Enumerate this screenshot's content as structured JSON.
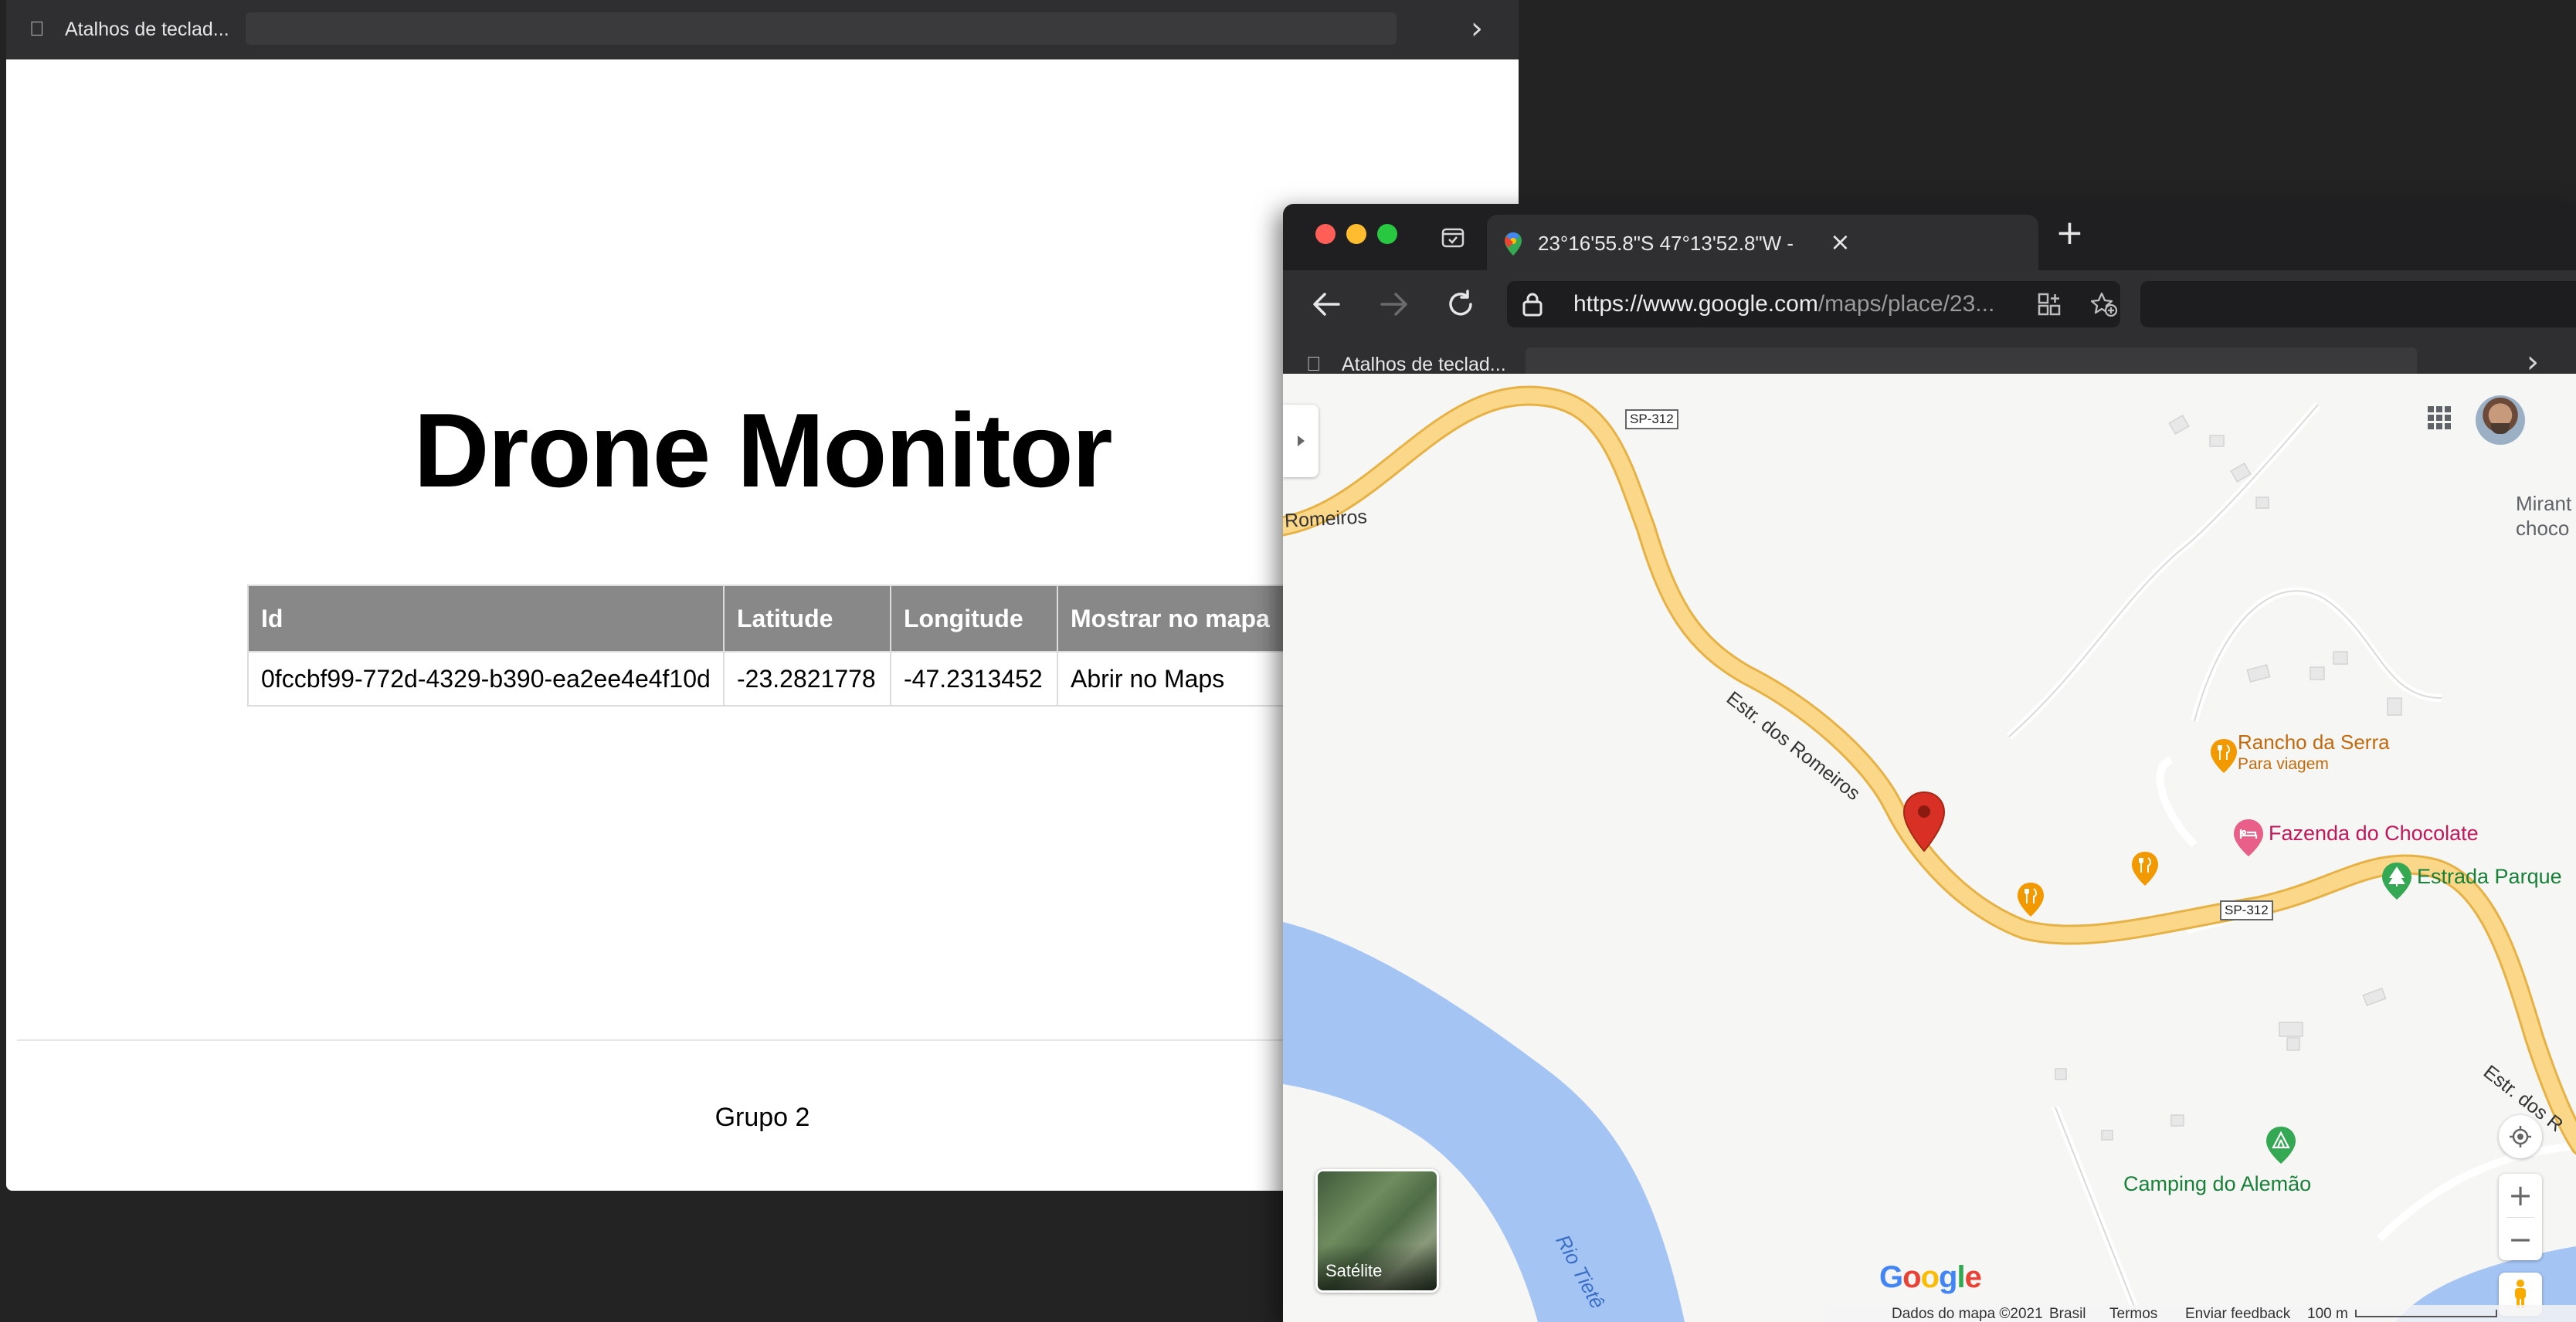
{
  "left_window": {
    "bookmarks_label": "Atalhos de teclad...",
    "page_title": "Drone Monitor",
    "table": {
      "headers": [
        "Id",
        "Latitude",
        "Longitude",
        "Mostrar no mapa"
      ],
      "rows": [
        {
          "id": "0fccbf99-772d-4329-b390-ea2ee4e4f10d",
          "latitude": "-23.2821778",
          "longitude": "-47.2313452",
          "action": "Abrir no Maps"
        }
      ]
    },
    "footer": "Grupo 2"
  },
  "right_window": {
    "tab_title": "23°16'55.8\"S 47°13'52.8\"W -",
    "url_host": "https://www.google.com",
    "url_path": "/maps/place/23...",
    "bookmarks_label": "Atalhos de teclad...",
    "map": {
      "road_shields": [
        "SP-312",
        "SP-312"
      ],
      "road_names": [
        "Romeiros",
        "Estr. dos Romeiros",
        "Estr. dos R"
      ],
      "river": "Rio Tietê",
      "places": [
        {
          "name": "Rancho da Serra",
          "subtitle": "Para viagem",
          "color": "#c26a0d"
        },
        {
          "name": "Fazenda do Chocolate",
          "color": "#c2185b"
        },
        {
          "name": "Estrada Parque",
          "color": "#188038"
        },
        {
          "name": "Camping do Alemão",
          "color": "#188038"
        },
        {
          "name": "Mirant\nchoco",
          "color": "#5f6368"
        }
      ],
      "satellite_label": "Satélite",
      "logo": "Google",
      "attribution": [
        "Dados do mapa ©2021",
        "Brasil",
        "Termos",
        "Enviar feedback",
        "100 m"
      ]
    }
  },
  "colors": {
    "table_header": "#888888",
    "road": "#fbd889",
    "road_edge": "#e6b246",
    "water": "#a4c4f4",
    "pin": "#d93025",
    "tab_bg": "#2f2f31"
  }
}
